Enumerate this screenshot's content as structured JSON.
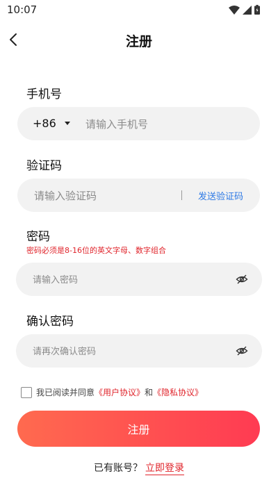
{
  "status_bar": {
    "time": "10:07",
    "icons": [
      "wifi-icon",
      "signal-icon",
      "battery-icon"
    ]
  },
  "header": {
    "title": "注册",
    "back_icon": "chevron-left-icon"
  },
  "phone": {
    "label": "手机号",
    "country_code": "+86",
    "placeholder": "请输入手机号"
  },
  "code": {
    "label": "验证码",
    "placeholder": "请输入验证码",
    "send_label": "发送验证码"
  },
  "password": {
    "label": "密码",
    "hint": "密码必须是8-16位的英文字母、数字组合",
    "placeholder": "请输入密码"
  },
  "confirm": {
    "label": "确认密码",
    "placeholder": "请再次确认密码"
  },
  "agreement": {
    "prefix": "我已阅读并同意",
    "user_agreement": "《用户协议》",
    "and": "和",
    "privacy_policy": "《隐私协议》"
  },
  "register_button": "注册",
  "login": {
    "prompt": "已有账号？",
    "link": "立即登录"
  },
  "colors": {
    "accent": "#ff3b52",
    "link_red": "#e0242b",
    "link_blue": "#2f7ae5",
    "input_bg": "#f2f2f2"
  }
}
